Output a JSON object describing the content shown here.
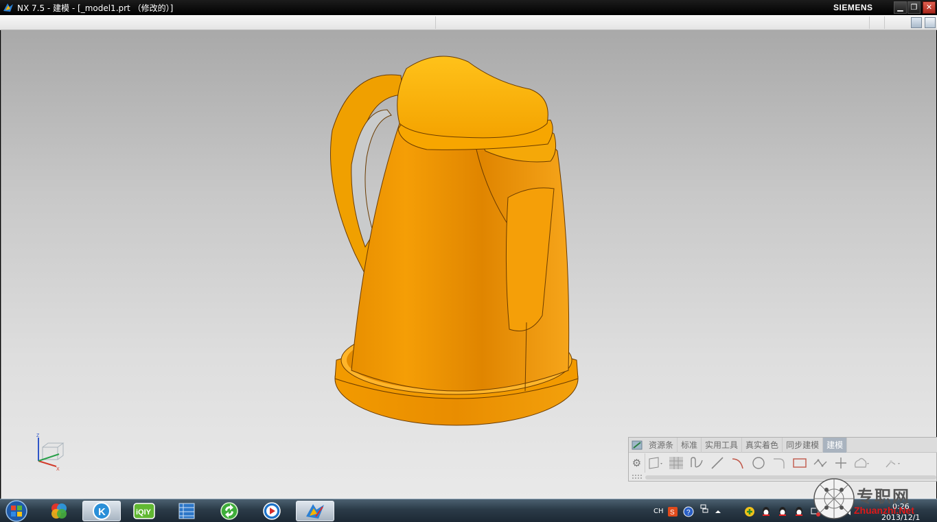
{
  "titlebar": {
    "title": "NX 7.5 - 建模 - [_model1.prt （修改的）]",
    "brand": "SIEMENS",
    "minimize_icon": "minimize-icon",
    "restore_icon": "restore-icon",
    "close_icon": "close-icon"
  },
  "toolbar": {
    "tabs": [
      "资源条",
      "标准",
      "实用工具",
      "真实着色",
      "同步建模",
      "建模"
    ],
    "active_tab": "建模",
    "tools": [
      "sketch-plane-icon",
      "grid-icon",
      "studio-spline-icon",
      "line-icon",
      "arc-icon",
      "circle-icon",
      "fillet-icon",
      "rectangle-icon",
      "polyline-icon",
      "point-icon",
      "shape-icon",
      "trim-icon"
    ]
  },
  "viewport": {
    "model": "kettle",
    "model_color": "#f09a00",
    "background_top": "#a9a9a9",
    "background_bottom": "#e9e9e9",
    "triad_label_z": "Z",
    "triad_label_x": "X"
  },
  "taskbar": {
    "apps": [
      "start-orb-icon",
      "media-player-icon",
      "kuwo-icon",
      "iqiyi-icon",
      "video-editor-icon",
      "refresh-app-icon",
      "media-play-icon",
      "nx-icon"
    ],
    "tray": {
      "lang": "CH",
      "time": "0:26",
      "date": "2013/12/1"
    }
  },
  "watermark": {
    "cn": "专职网",
    "en": "Zhuanzhi.Net"
  }
}
